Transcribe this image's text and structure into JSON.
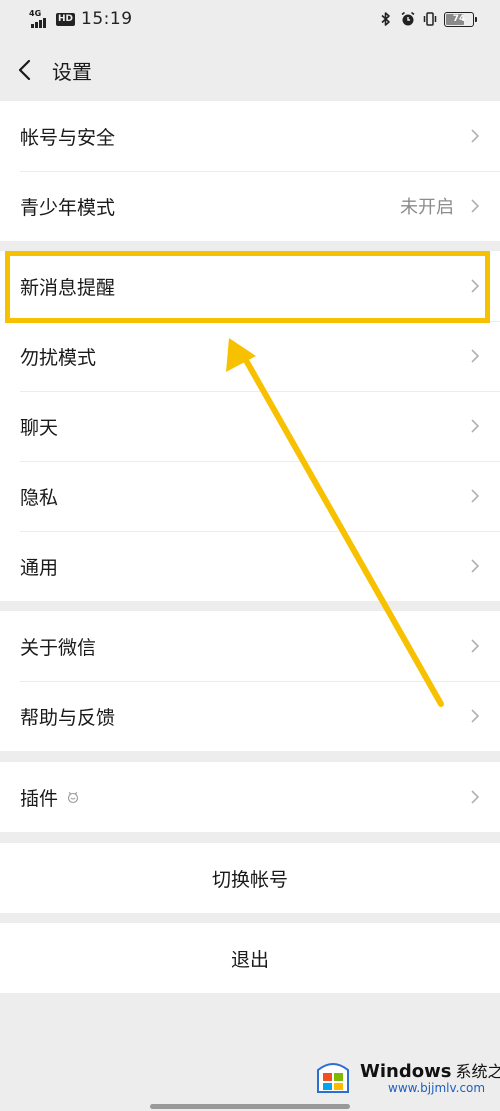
{
  "status_bar": {
    "network": "4G",
    "hd": "HD",
    "time": "15:19",
    "battery": {
      "level": "74",
      "fraction": 0.74
    },
    "icons": [
      "bluetooth-icon",
      "alarm-icon",
      "vibrate-icon",
      "battery-icon"
    ]
  },
  "nav": {
    "title": "设置",
    "back_icon": "chevron-left-icon"
  },
  "groups": {
    "account": {
      "account_security": "帐号与安全",
      "teen_mode": "青少年模式",
      "teen_mode_value": "未开启"
    },
    "settings": {
      "new_message": "新消息提醒",
      "do_not_disturb": "勿扰模式",
      "chat": "聊天",
      "privacy": "隐私",
      "general": "通用"
    },
    "about": {
      "about_wechat": "关于微信",
      "help_feedback": "帮助与反馈"
    },
    "plugins": {
      "label": "插件"
    }
  },
  "actions": {
    "switch_account": "切换帐号",
    "logout": "退出"
  },
  "annotation": {
    "color": "#f7c100"
  },
  "watermark": {
    "brand": "Windows",
    "cn": "系统之家",
    "url": "www.bjjmlv.com"
  }
}
